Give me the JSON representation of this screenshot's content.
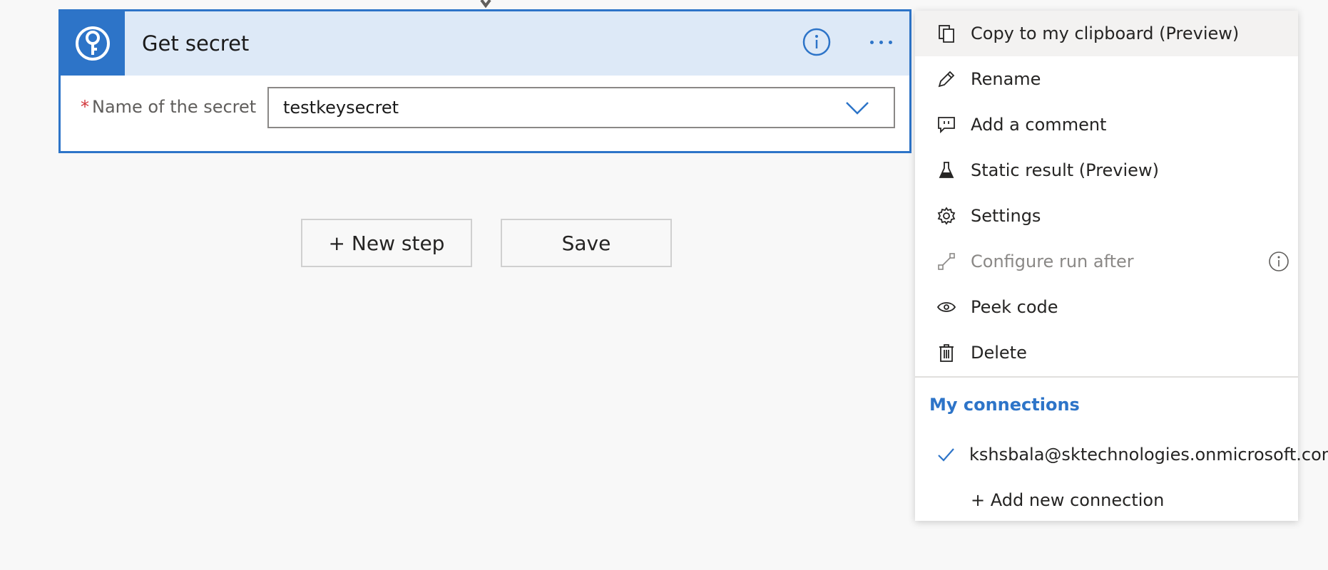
{
  "card": {
    "title": "Get secret",
    "field_required_mark": "*",
    "field_label": "Name of the secret",
    "field_value": "testkeysecret"
  },
  "actions": {
    "new_step_label": "+ New step",
    "save_label": "Save"
  },
  "menu": {
    "items": [
      {
        "label": "Copy to my clipboard (Preview)",
        "icon": "copy-icon"
      },
      {
        "label": "Rename",
        "icon": "pencil-icon"
      },
      {
        "label": "Add a comment",
        "icon": "comment-icon"
      },
      {
        "label": "Static result (Preview)",
        "icon": "flask-icon"
      },
      {
        "label": "Settings",
        "icon": "gear-icon"
      },
      {
        "label": "Configure run after",
        "icon": "run-after-icon",
        "disabled": true
      },
      {
        "label": "Peek code",
        "icon": "eye-icon"
      },
      {
        "label": "Delete",
        "icon": "trash-icon"
      }
    ],
    "connections_heading": "My connections",
    "connections": [
      {
        "label": "kshsbala@sktechnologies.onmicrosoft.com",
        "selected": true
      }
    ],
    "add_connection_label": "+ Add new connection"
  },
  "colors": {
    "accent": "#2d74c8",
    "header_bg": "#dde9f7",
    "canvas_bg": "#f8f8f8",
    "required": "#d13438"
  }
}
